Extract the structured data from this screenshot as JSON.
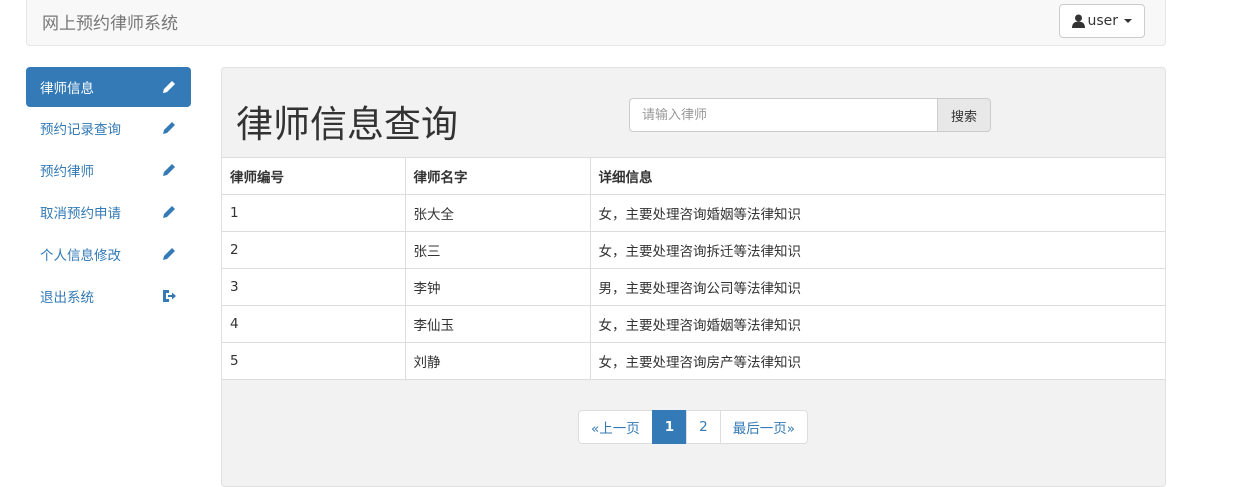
{
  "navbar": {
    "brand": "网上预约律师系统",
    "user_label": "user"
  },
  "sidebar": {
    "items": [
      {
        "label": "律师信息",
        "icon": "pencil-icon",
        "active": true
      },
      {
        "label": "预约记录查询",
        "icon": "pencil-icon",
        "active": false
      },
      {
        "label": "预约律师",
        "icon": "pencil-icon",
        "active": false
      },
      {
        "label": "取消预约申请",
        "icon": "pencil-icon",
        "active": false
      },
      {
        "label": "个人信息修改",
        "icon": "pencil-icon",
        "active": false
      },
      {
        "label": "退出系统",
        "icon": "logout-icon",
        "active": false
      }
    ]
  },
  "main": {
    "title": "律师信息查询",
    "search": {
      "placeholder": "请输入律师",
      "value": "",
      "button_label": "搜索"
    },
    "table": {
      "headers": [
        "律师编号",
        "律师名字",
        "详细信息"
      ],
      "rows": [
        [
          "1",
          "张大全",
          "女，主要处理咨询婚姻等法律知识"
        ],
        [
          "2",
          "张三",
          "女，主要处理咨询拆迁等法律知识"
        ],
        [
          "3",
          "李钟",
          "男，主要处理咨询公司等法律知识"
        ],
        [
          "4",
          "李仙玉",
          "女，主要处理咨询婚姻等法律知识"
        ],
        [
          "5",
          "刘静",
          "女，主要处理咨询房产等法律知识"
        ]
      ]
    },
    "pagination": {
      "prev_label": "«上一页",
      "pages": [
        "1",
        "2"
      ],
      "current": "1",
      "last_label": "最后一页»"
    }
  },
  "colors": {
    "primary": "#337ab7",
    "navbar_bg": "#f8f8f8",
    "panel_bg": "#f2f2f2"
  }
}
